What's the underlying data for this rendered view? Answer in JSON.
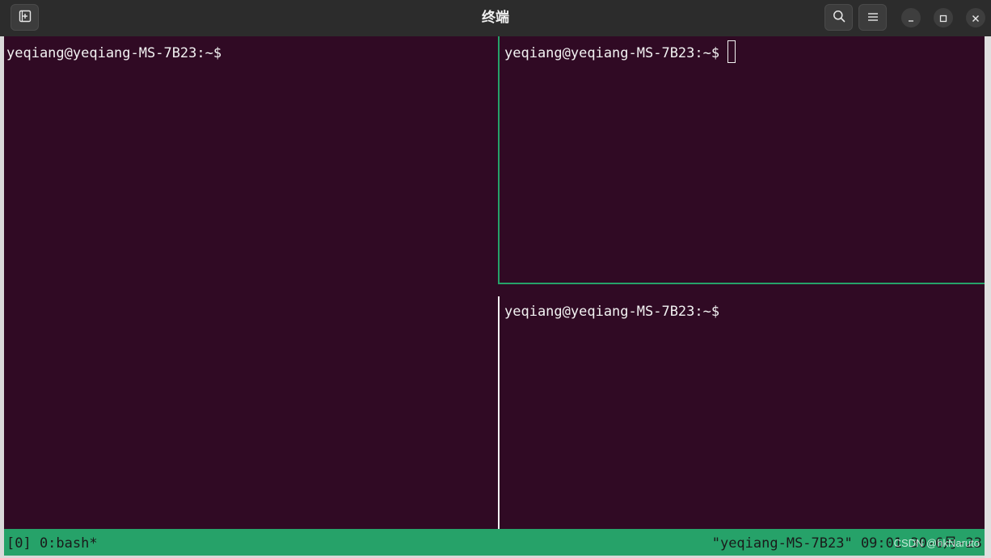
{
  "window": {
    "title": "终端"
  },
  "titlebar": {
    "new_tab_icon": "new-tab-icon",
    "search_icon": "search-icon",
    "menu_icon": "hamburger-menu-icon",
    "minimize_icon": "minimize-icon",
    "maximize_icon": "maximize-icon",
    "close_icon": "close-icon"
  },
  "terminal": {
    "background": "#300a24",
    "foreground": "#f2f2f2",
    "accent": "#26a269",
    "panes": [
      {
        "prompt": "yeqiang@yeqiang-MS-7B23:~$",
        "active": false
      },
      {
        "prompt": "yeqiang@yeqiang-MS-7B23:~$",
        "active": true
      },
      {
        "prompt": "yeqiang@yeqiang-MS-7B23:~$",
        "active": false
      }
    ]
  },
  "statusbar": {
    "left": "[0] 0:bash*",
    "right": "\"yeqiang-MS-7B23\" 09:01 30-6月-23"
  },
  "watermark": "CSDN @hkNaruto"
}
